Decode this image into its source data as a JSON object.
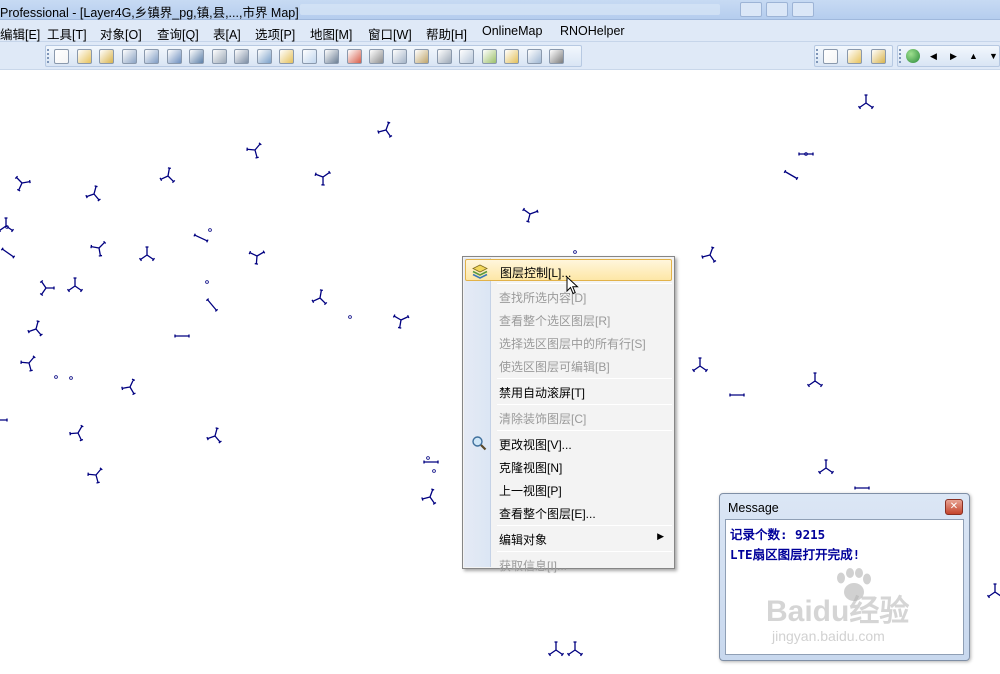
{
  "window": {
    "title": "Professional - [Layer4G,乡镇界_pg,镇,县,...,市界 Map]"
  },
  "menubar": {
    "items": [
      {
        "label": "编辑[E]",
        "id": "edit"
      },
      {
        "label": "工具[T]",
        "id": "tools"
      },
      {
        "label": "对象[O]",
        "id": "objects"
      },
      {
        "label": "查询[Q]",
        "id": "query"
      },
      {
        "label": "表[A]",
        "id": "table"
      },
      {
        "label": "选项[P]",
        "id": "options"
      },
      {
        "label": "地图[M]",
        "id": "map"
      },
      {
        "label": "窗口[W]",
        "id": "window"
      },
      {
        "label": "帮助[H]",
        "id": "help"
      },
      {
        "label": "OnlineMap",
        "id": "onlinemap"
      },
      {
        "label": "RNOHelper",
        "id": "rnohelper"
      }
    ]
  },
  "toolbar": {
    "main_icons": [
      "new-icon",
      "open-icon",
      "open-workspace-icon",
      "close-table-icon",
      "save-copy-icon",
      "save-query-icon",
      "find-icon",
      "find-select-icon",
      "save-icon",
      "save-workspace-icon",
      "open-folder-icon",
      "new-browser-icon",
      "print-icon",
      "export-icon",
      "cut-icon",
      "copy-icon",
      "paste-icon",
      "undo-icon",
      "clip-region-icon",
      "graph-icon",
      "layout-icon",
      "legend-icon",
      "statistics-icon"
    ],
    "right_icons": [
      "catalog-icon",
      "layer-tool-icon",
      "globe-icon"
    ],
    "nav_icons": [
      "globe-nav-icon",
      "arrow-left-icon",
      "arrow-right-icon",
      "arrow-up-icon",
      "arrow-down-icon"
    ]
  },
  "context_menu": {
    "items": [
      {
        "label": "图层控制[L]...",
        "enabled": true,
        "highlighted": true,
        "icon": "layers-icon"
      },
      {
        "sep": true
      },
      {
        "label": "查找所选内容[D]",
        "enabled": false
      },
      {
        "label": "查看整个选区图层[R]",
        "enabled": false
      },
      {
        "label": "选择选区图层中的所有行[S]",
        "enabled": false
      },
      {
        "label": "使选区图层可编辑[B]",
        "enabled": false
      },
      {
        "sep": true
      },
      {
        "label": "禁用自动滚屏[T]",
        "enabled": true
      },
      {
        "sep": true
      },
      {
        "label": "清除装饰图层[C]",
        "enabled": false
      },
      {
        "sep": true
      },
      {
        "label": "更改视图[V]...",
        "enabled": true,
        "icon": "zoom-icon"
      },
      {
        "label": "克隆视图[N]",
        "enabled": true
      },
      {
        "label": "上一视图[P]",
        "enabled": true
      },
      {
        "label": "查看整个图层[E]...",
        "enabled": true
      },
      {
        "sep": true
      },
      {
        "label": "编辑对象",
        "enabled": true,
        "submenu": true
      },
      {
        "sep": true
      },
      {
        "label": "获取信息[I]...",
        "enabled": false
      }
    ]
  },
  "message_window": {
    "title": "Message",
    "lines": [
      "记录个数: 9215",
      "LTE扇区图层打开完成!"
    ]
  },
  "watermark": {
    "brand": "Baidu经验",
    "url": "jingyan.baidu.com"
  },
  "colors": {
    "site_symbol": "#000080",
    "highlight_border": "#e2b249",
    "message_text": "#00009a"
  }
}
